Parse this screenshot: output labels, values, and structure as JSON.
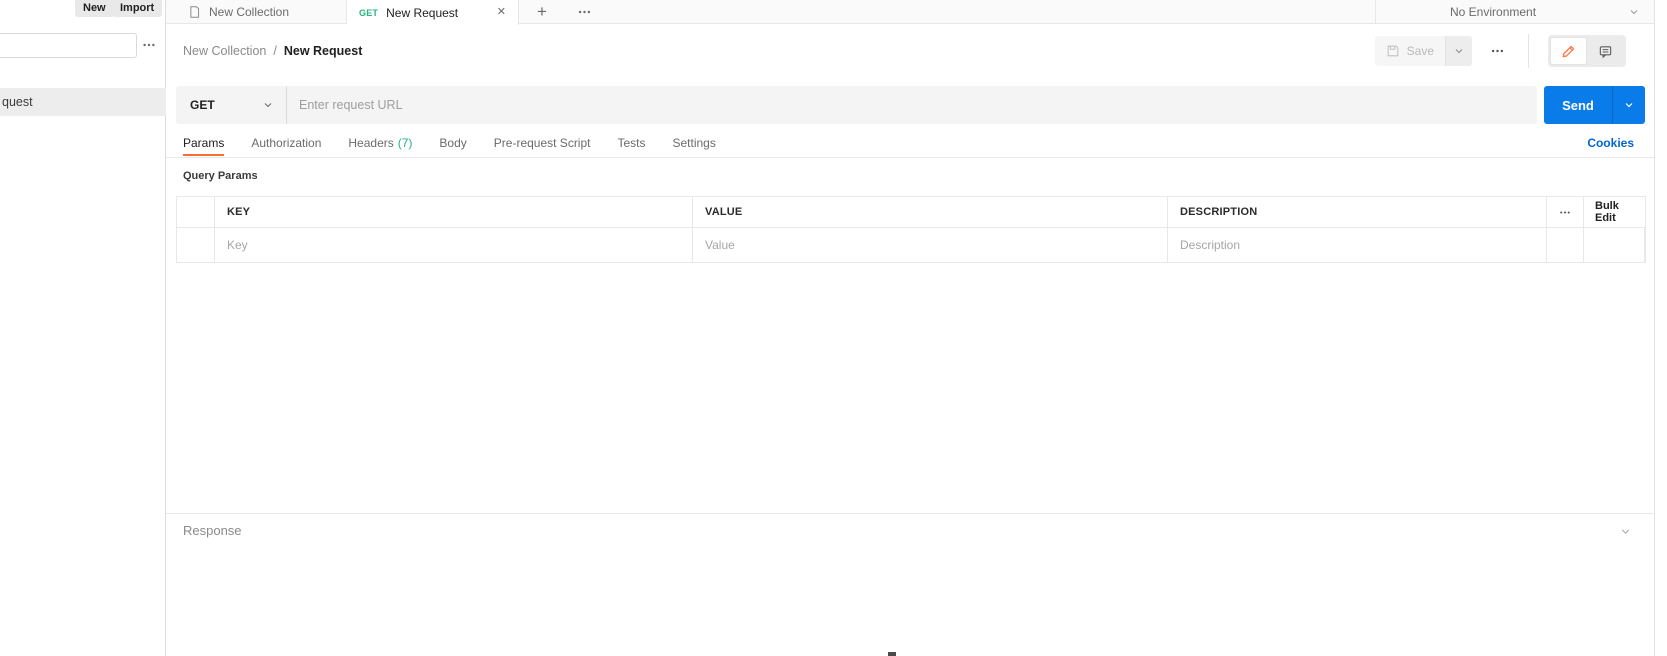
{
  "colors": {
    "accent_orange": "#FF6C37",
    "primary_blue": "#0A7CEA",
    "method_get_green": "#26B47F",
    "link_blue": "#0265D2"
  },
  "sidebar": {
    "new_button": "New",
    "import_button": "Import",
    "search_value": "",
    "selected_item": "quest"
  },
  "tab_strip": {
    "collection_tab": "New Collection",
    "request_tab": {
      "method": "GET",
      "title": "New Request",
      "close": "✕"
    },
    "plus": "+",
    "environment": {
      "selected": "No Environment"
    }
  },
  "header": {
    "breadcrumb": {
      "collection": "New Collection",
      "separator": "/",
      "request": "New Request"
    },
    "save_button": "Save"
  },
  "request_bar": {
    "method": "GET",
    "url_placeholder": "Enter request URL",
    "send_button": "Send"
  },
  "request_tabs": {
    "items": [
      {
        "label": "Params"
      },
      {
        "label": "Authorization"
      },
      {
        "label": "Headers",
        "count": "(7)"
      },
      {
        "label": "Body"
      },
      {
        "label": "Pre-request Script"
      },
      {
        "label": "Tests"
      },
      {
        "label": "Settings"
      }
    ],
    "cookies_link": "Cookies"
  },
  "params_section": {
    "title": "Query Params",
    "table": {
      "headers": {
        "key": "KEY",
        "value": "VALUE",
        "description": "DESCRIPTION",
        "bulk_edit": "Bulk Edit"
      },
      "row_placeholders": {
        "key": "Key",
        "value": "Value",
        "description": "Description"
      }
    }
  },
  "response_section": {
    "title": "Response"
  }
}
